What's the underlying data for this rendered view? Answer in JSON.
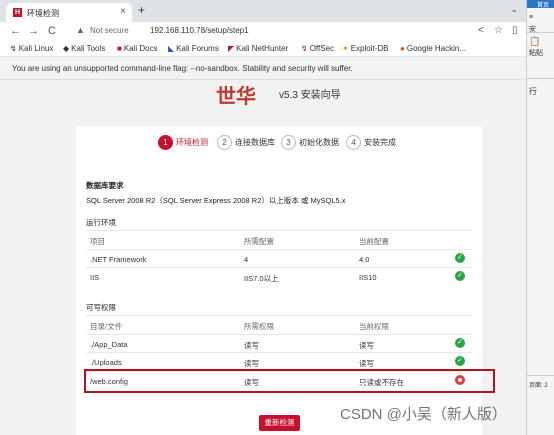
{
  "browser": {
    "tab_title": "环境检测",
    "tab_close": "×",
    "new_tab": "+",
    "tab_menu": "⌄",
    "nav_back": "←",
    "nav_forward": "→",
    "nav_reload": "C",
    "security_label": "Not secure",
    "url": "192.168.110.78/setup/step1",
    "share": "<",
    "star": "☆",
    "sidepanel": "▯",
    "bookmarks": [
      {
        "label": "Kali Linux",
        "icon": "↯"
      },
      {
        "label": "Kali Tools",
        "icon": "◆"
      },
      {
        "label": "Kali Docs",
        "icon": "■"
      },
      {
        "label": "Kali Forums",
        "icon": "◣"
      },
      {
        "label": "Kali NetHunter",
        "icon": "◤"
      },
      {
        "label": "OffSec",
        "icon": "↯"
      },
      {
        "label": "Exploit-DB",
        "icon": "✦"
      },
      {
        "label": "Google Hackin...",
        "icon": "●"
      }
    ],
    "warning": "You are using an unsupported command-line flag: --no-sandbox. Stability and security will suffer."
  },
  "page": {
    "logo": "世华",
    "version": "v5.3 安装向导",
    "steps": [
      {
        "num": "1",
        "label": "环境检测",
        "active": true
      },
      {
        "num": "2",
        "label": "连接数据库",
        "active": false
      },
      {
        "num": "3",
        "label": "初始化数据",
        "active": false
      },
      {
        "num": "4",
        "label": "安装完成",
        "active": false
      }
    ],
    "db_title": "数据库要求",
    "db_text": "SQL Server 2008 R2（SQL Server Express 2008 R2）以上版本 或 MySQL5.x",
    "runtime_title": "运行环境",
    "runtime_headers": [
      "项目",
      "所需配置",
      "当前配置"
    ],
    "runtime_rows": [
      {
        "item": ".NET Framework",
        "required": "4",
        "current": "4.0",
        "status": "ok"
      },
      {
        "item": "IIS",
        "required": "IIS7.0以上",
        "current": "IIS10",
        "status": "ok"
      }
    ],
    "perm_title": "可写权限",
    "perm_headers": [
      "目录/文件",
      "所需权限",
      "当前权限"
    ],
    "perm_rows": [
      {
        "item": "./App_Data",
        "required": "读写",
        "current": "读写",
        "status": "ok"
      },
      {
        "item": "./Uploads",
        "required": "读写",
        "current": "读写",
        "status": "ok"
      },
      {
        "item": "/web.config",
        "required": "读写",
        "current": "只读或不存在",
        "status": "error"
      }
    ],
    "retry": "重新检测",
    "ok_mark": "✓"
  },
  "watermark": "CSDN @小吴（新人版）",
  "right_panel": {
    "top": "首页",
    "line1": "≡",
    "line2": "安",
    "paste": "粘贴",
    "heading": "行",
    "footer": "页面: 2"
  },
  "colors": {
    "accent": "#c8102e",
    "ok": "#27a844",
    "error": "#e53935",
    "highlight_border": "#b0141c"
  }
}
